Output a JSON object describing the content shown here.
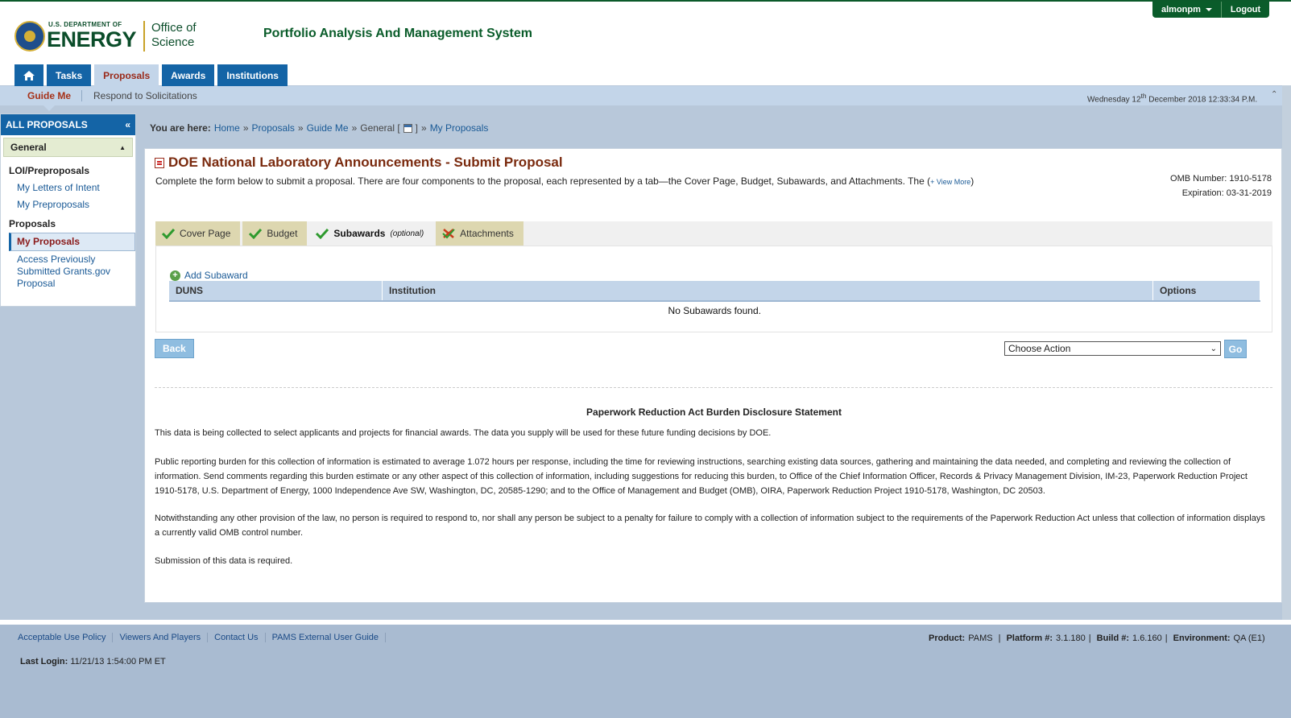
{
  "header": {
    "logo_small": "U.S. DEPARTMENT OF",
    "logo_big": "ENERGY",
    "office_line1": "Office of",
    "office_line2": "Science",
    "app_title": "Portfolio Analysis And Management System",
    "user": "almonpm",
    "logout": "Logout"
  },
  "nav": {
    "tabs": [
      "Tasks",
      "Proposals",
      "Awards",
      "Institutions"
    ],
    "active": "Proposals"
  },
  "subnav": {
    "guide_me": "Guide Me",
    "respond": "Respond to Solicitations",
    "date_prefix": "Wednesday 12",
    "date_suffix_sup": "th",
    "date_rest": " December 2018 12:33:34 P.M."
  },
  "sidebar": {
    "title": "ALL PROPOSALS",
    "section": "General",
    "groups": [
      {
        "label": "LOI/Preproposals",
        "items": [
          "My Letters of Intent",
          "My Preproposals"
        ]
      },
      {
        "label": "Proposals",
        "items": [
          "My Proposals",
          "Access Previously Submitted Grants.gov Proposal"
        ]
      }
    ],
    "active_item": "My Proposals"
  },
  "breadcrumb": {
    "prefix": "You are here:",
    "items": [
      "Home",
      "Proposals",
      "Guide Me",
      "General [",
      "]",
      "My Proposals"
    ]
  },
  "main": {
    "title": "DOE National Laboratory Announcements - Submit Proposal",
    "intro": "Complete the form below to submit a proposal. There are four components to the proposal, each represented by a tab—the Cover Page, Budget, Subawards, and Attachments. The (",
    "view_more": "+ View More",
    "intro_end": ")",
    "omb_number": "OMB Number: 1910-5178",
    "expiration": "Expiration: 03-31-2019",
    "tabs": [
      {
        "label": "Cover Page",
        "status": "complete"
      },
      {
        "label": "Budget",
        "status": "complete"
      },
      {
        "label": "Subawards",
        "suffix": "(optional)",
        "status": "complete",
        "active": true
      },
      {
        "label": "Attachments",
        "status": "incomplete"
      }
    ],
    "add_subaward": "Add Subaward",
    "table": {
      "headers": [
        "DUNS",
        "Institution",
        "Options"
      ],
      "empty": "No Subawards found."
    },
    "back": "Back",
    "action_select": "Choose Action",
    "go": "Go",
    "pra_title": "Paperwork Reduction Act Burden Disclosure Statement",
    "pra_p1": "This data is being collected to select applicants and projects for financial awards. The data you supply will be used for these future funding decisions by DOE.",
    "pra_p2": "Public reporting burden for this collection of information is estimated to average 1.072 hours per response, including the time for reviewing instructions, searching existing data sources, gathering and maintaining the data needed, and completing and reviewing the collection of information. Send comments regarding this burden estimate or any other aspect of this collection of information, including suggestions for reducing this burden, to Office of the Chief Information Officer, Records & Privacy Management Division, IM-23, Paperwork Reduction Project 1910-5178, U.S. Department of Energy, 1000 Independence Ave SW, Washington, DC, 20585-1290; and to the Office of Management and Budget (OMB), OIRA, Paperwork Reduction Project 1910-5178, Washington, DC 20503.",
    "pra_p3": "Notwithstanding any other provision of the law, no person is required to respond to, nor shall any person be subject to a penalty for failure to comply with a collection of information subject to the requirements of the Paperwork Reduction Act unless that collection of information displays a currently valid OMB control number.",
    "pra_p4": "Submission of this data is required."
  },
  "footer": {
    "links": [
      "Acceptable Use Policy",
      "Viewers And Players",
      "Contact Us",
      "PAMS External User Guide"
    ],
    "last_login_label": "Last Login:",
    "last_login_value": "11/21/13 1:54:00 PM ET",
    "product_label": "Product:",
    "product": "PAMS",
    "platform_label": "Platform #:",
    "platform": "3.1.180",
    "build_label": "Build #:",
    "build": "1.6.160",
    "env_label": "Environment:",
    "env": "QA (E1)"
  },
  "colors": {
    "nav_blue": "#1464a6",
    "doe_green": "#0b4d2a",
    "title_brown": "#7a2a0e"
  },
  "icons": [
    "home-icon",
    "collapse-icon",
    "calendar-icon",
    "check-icon",
    "warning-icon",
    "plus-icon",
    "chevron-down-icon"
  ]
}
